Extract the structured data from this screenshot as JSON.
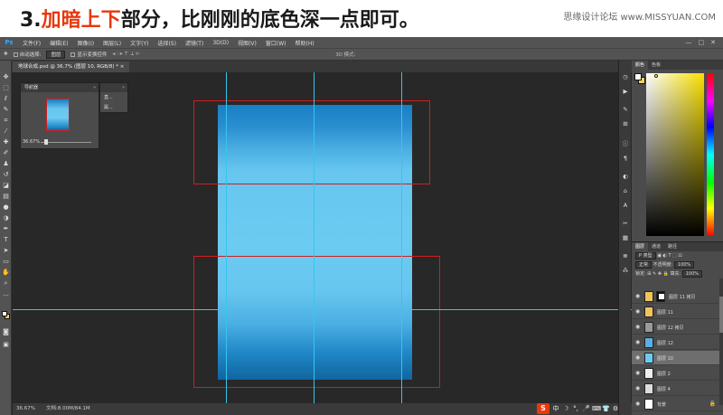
{
  "banner": {
    "step": "3.",
    "highlight": "加暗上下",
    "rest": "部分，比刚刚的底色深一点即可。",
    "site": "思缘设计论坛 www.MISSYUAN.COM"
  },
  "app": {
    "logo": "Ps",
    "menus": [
      "文件(F)",
      "编辑(E)",
      "图像(I)",
      "图层(L)",
      "文字(Y)",
      "选择(S)",
      "滤镜(T)",
      "3D(D)",
      "视图(V)",
      "窗口(W)",
      "帮助(H)"
    ],
    "window_controls": [
      "—",
      "□",
      "✕"
    ]
  },
  "options": {
    "auto_select_label": "自动选择:",
    "auto_select_value": "图层",
    "transform_label": "显示变换控件",
    "mode3d_label": "3D 模式:"
  },
  "document": {
    "tab_label": "地球合成.psd @ 36.7% (图层 10, RGB/8) * ×",
    "zoom": "36.67%",
    "doc_info": "文档:8.00M/84.1M"
  },
  "navigator": {
    "title": "导航器",
    "zoom": "36.67%"
  },
  "histogram": {
    "rows": [
      "直...",
      "属..."
    ]
  },
  "color_panel": {
    "tabs": [
      "颜色",
      "色板"
    ],
    "fg": "#ffffff",
    "bg": "#f0d15c"
  },
  "layers_panel": {
    "tabs": [
      "图层",
      "通道",
      "路径"
    ],
    "kind_label": "P 类型",
    "blend_mode": "正常",
    "opacity_label": "不透明度:",
    "opacity": "100%",
    "lock_label": "锁定:",
    "fill_label": "填充:",
    "fill": "100%",
    "layers": [
      {
        "name": "图层 11 拷贝",
        "thumb": "#f2c45c",
        "mask": true,
        "active": false
      },
      {
        "name": "图层 11",
        "thumb": "#f2c45c",
        "mask": false,
        "active": false
      },
      {
        "name": "图层 12 拷贝",
        "thumb": "#9a9a9a",
        "mask": false,
        "active": false
      },
      {
        "name": "图层 12",
        "thumb": "#5aaee0",
        "mask": false,
        "active": false
      },
      {
        "name": "图层 10",
        "thumb": "#6ccbf0",
        "mask": false,
        "active": true
      },
      {
        "name": "图层 2",
        "thumb": "#eeeeee",
        "mask": false,
        "active": false
      },
      {
        "name": "图层 4",
        "thumb": "#dddddd",
        "mask": false,
        "active": false
      },
      {
        "name": "背景",
        "thumb": "#ffffff",
        "mask": false,
        "active": false
      }
    ]
  },
  "tray": {
    "badge": "S",
    "icons": [
      "中",
      "☽",
      "°,",
      "🎤",
      "⌨",
      "👕",
      "⚙"
    ]
  }
}
